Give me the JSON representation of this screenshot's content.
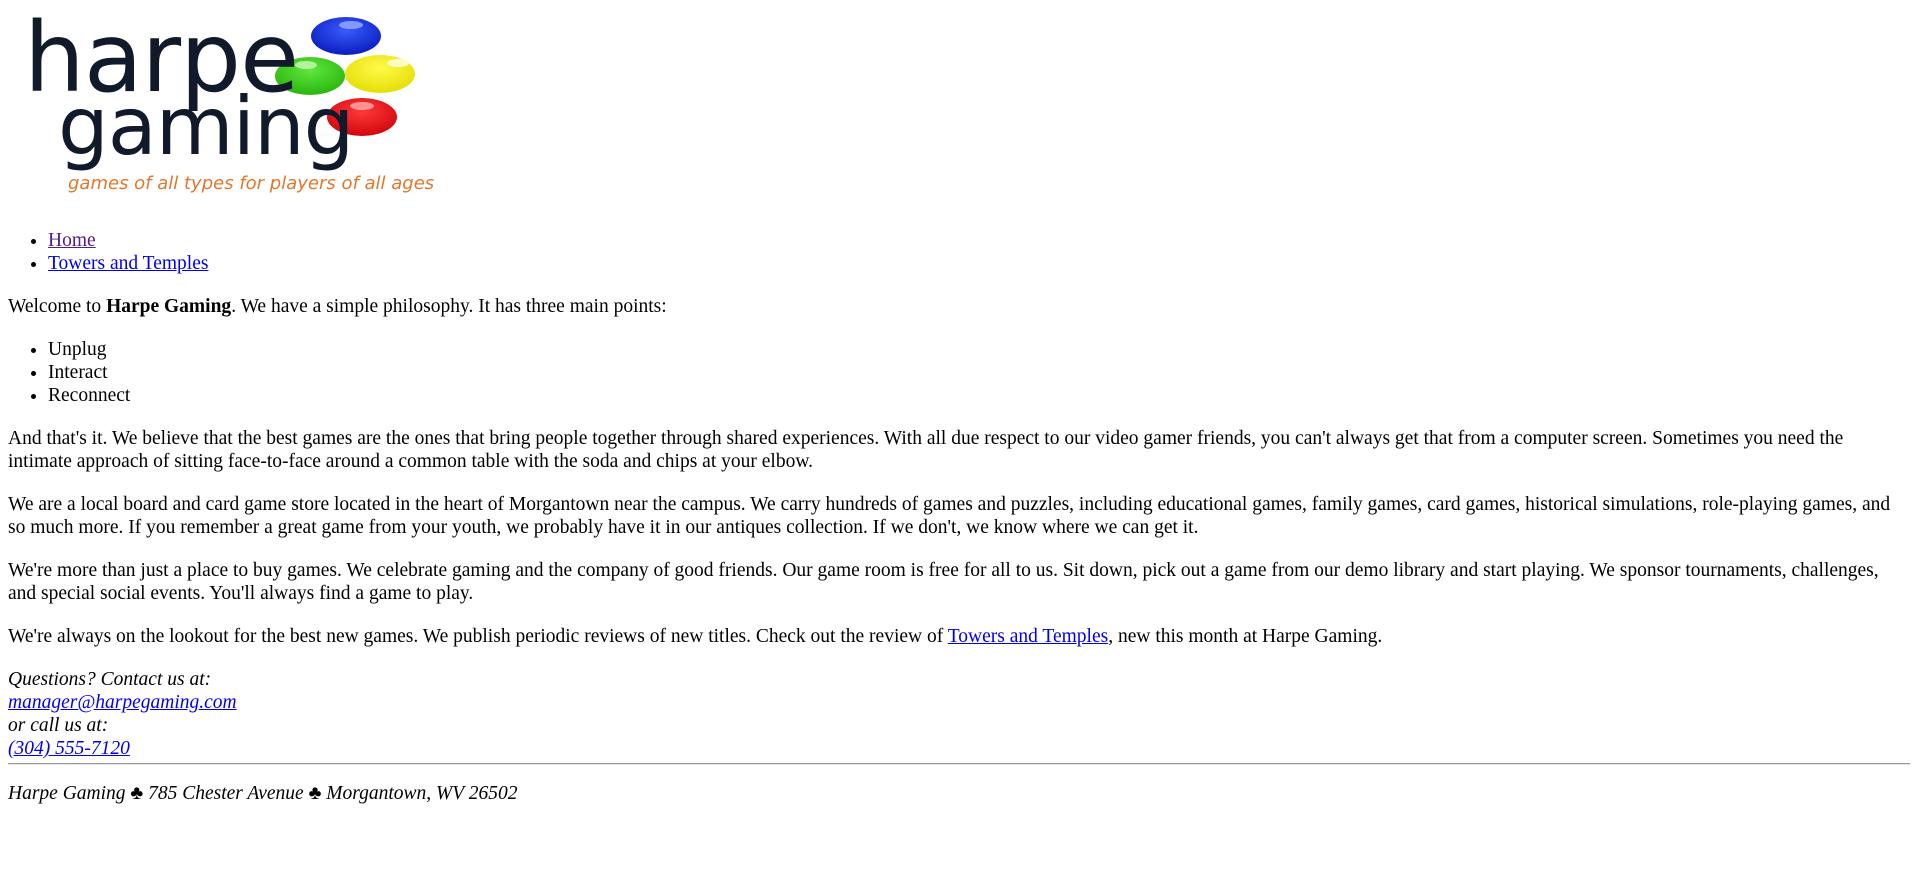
{
  "logo": {
    "word1": "harpe",
    "word2": "gaming",
    "tagline": "games of all types for players of all ages",
    "colors": {
      "text": "#111a2b",
      "tagline": "#e4772b",
      "blue": "#1432e0",
      "green": "#3fd11e",
      "yellow": "#f7f51e",
      "red": "#f0161b"
    }
  },
  "nav": [
    {
      "label": "Home"
    },
    {
      "label": "Towers and Temples"
    }
  ],
  "intro": {
    "before": "Welcome to ",
    "brand": "Harpe Gaming",
    "after": ". We have a simple philosophy. It has three main points:"
  },
  "points": [
    "Unplug",
    "Interact",
    "Reconnect"
  ],
  "paragraphs": [
    "And that's it. We believe that the best games are the ones that bring people together through shared experiences. With all due respect to our video gamer friends, you can't always get that from a computer screen. Sometimes you need the intimate approach of sitting face-to-face around a common table with the soda and chips at your elbow.",
    "We are a local board and card game store located in the heart of Morgantown near the campus. We carry hundreds of games and puzzles, including educational games, family games, card games, historical simulations, role-playing games, and so much more. If you remember a great game from your youth, we probably have it in our antiques collection. If we don't, we know where we can get it.",
    "We're more than just a place to buy games. We celebrate gaming and the company of good friends. Our game room is free for all to us. Sit down, pick out a game from our demo library and start playing. We sponsor tournaments, challenges, and special social events. You'll always find a game to play."
  ],
  "review": {
    "before": "We're always on the lookout for the best new games. We publish periodic reviews of new titles. Check out the review of ",
    "link": "Towers and Temples",
    "after": ", new this month at Harpe Gaming."
  },
  "contact": {
    "line1": "Questions? Contact us at:",
    "email": "manager@harpegaming.com",
    "line2": "or call us at:",
    "phone": "(304) 555-7120"
  },
  "footer": "Harpe Gaming ♣ 785 Chester Avenue ♣ Morgantown, WV 26502"
}
